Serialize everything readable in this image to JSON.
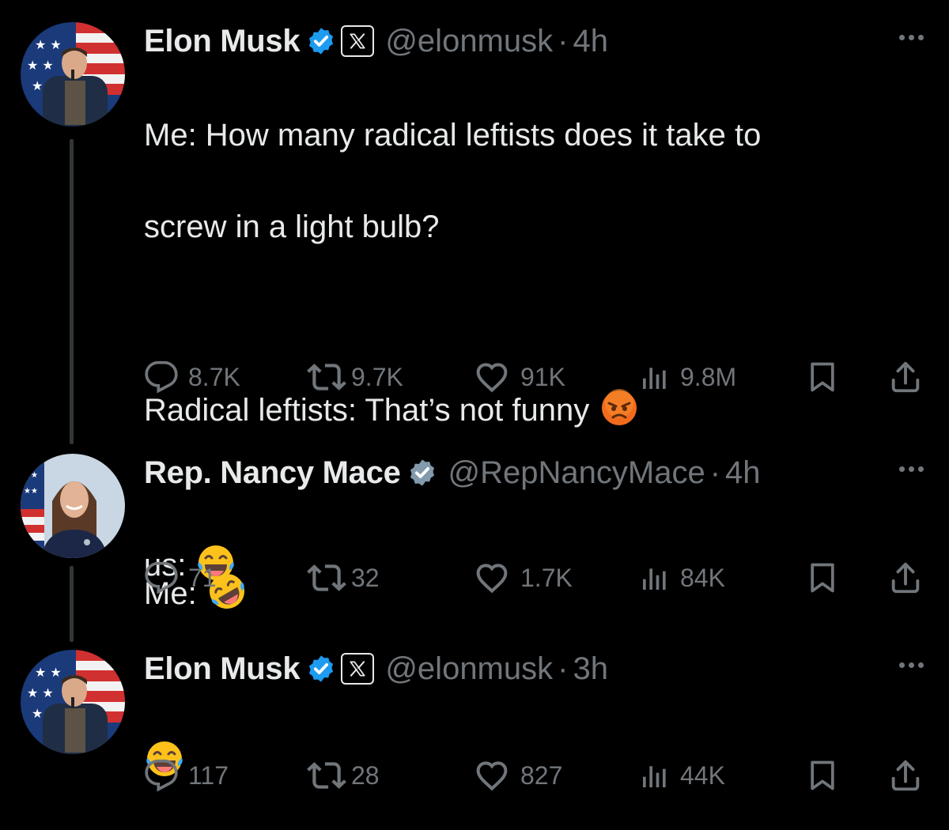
{
  "tweets": [
    {
      "author": {
        "name": "Elon Musk",
        "handle": "@elonmusk",
        "verified": true,
        "affiliation_badge": "X",
        "avatar": "elon-musk-avatar"
      },
      "time": "4h",
      "text_lines": [
        "Me: How many radical leftists does it take to",
        "screw in a light bulb?",
        "",
        "Radical leftists: That’s not funny",
        "",
        "Me:"
      ],
      "emojis": [
        "angry-face-emoji",
        "rolling-on-floor-laughing-emoji"
      ],
      "stats": {
        "replies": "8.7K",
        "reposts": "9.7K",
        "likes": "91K",
        "views": "9.8M"
      }
    },
    {
      "author": {
        "name": "Rep. Nancy Mace",
        "handle": "@RepNancyMace",
        "verified": true,
        "verified_color": "gray",
        "avatar": "nancy-mace-avatar"
      },
      "time": "4h",
      "text_lines": [
        "us:"
      ],
      "emojis": [
        "face-with-tears-of-joy-emoji"
      ],
      "stats": {
        "replies": "71",
        "reposts": "32",
        "likes": "1.7K",
        "views": "84K"
      }
    },
    {
      "author": {
        "name": "Elon Musk",
        "handle": "@elonmusk",
        "verified": true,
        "affiliation_badge": "X",
        "avatar": "elon-musk-avatar"
      },
      "time": "3h",
      "text_lines": [],
      "emojis": [
        "face-with-tears-of-joy-emoji"
      ],
      "stats": {
        "replies": "117",
        "reposts": "28",
        "likes": "827",
        "views": "44K"
      }
    }
  ],
  "separator": "·",
  "colors": {
    "background": "#000000",
    "primary_text": "#e7e9ea",
    "secondary_text": "#71767b",
    "verified_blue": "#1d9bf0",
    "verified_gray": "#829aab",
    "thread_line": "#333639"
  }
}
